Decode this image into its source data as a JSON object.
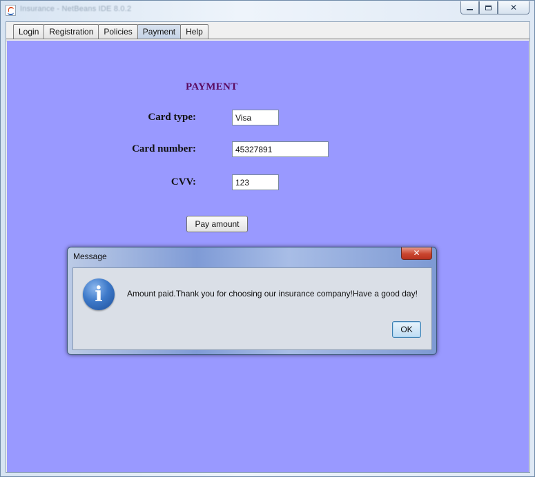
{
  "window": {
    "title": "Insurance - NetBeans IDE 8.0.2",
    "controls": {
      "minimize": "minimize",
      "restore": "restore",
      "close": "close"
    }
  },
  "tabs": [
    {
      "label": "Login",
      "selected": false
    },
    {
      "label": "Registration",
      "selected": false
    },
    {
      "label": "Policies",
      "selected": false
    },
    {
      "label": "Payment",
      "selected": true
    },
    {
      "label": "Help",
      "selected": false
    }
  ],
  "payment": {
    "title": "PAYMENT",
    "card_type_label": "Card type:",
    "card_type_value": "Visa",
    "card_number_label": "Card number:",
    "card_number_value": "45327891",
    "cvv_label": "CVV:",
    "cvv_value": "123",
    "pay_button": "Pay amount"
  },
  "dialog": {
    "title": "Message",
    "close_glyph": "✕",
    "icon": "information-icon",
    "icon_glyph": "i",
    "message": "Amount paid.Thank you for choosing our insurance company!Have a good day!",
    "ok_button": "OK"
  },
  "colors": {
    "panel_background": "#9999ff",
    "title_color": "#5a0a5f"
  }
}
